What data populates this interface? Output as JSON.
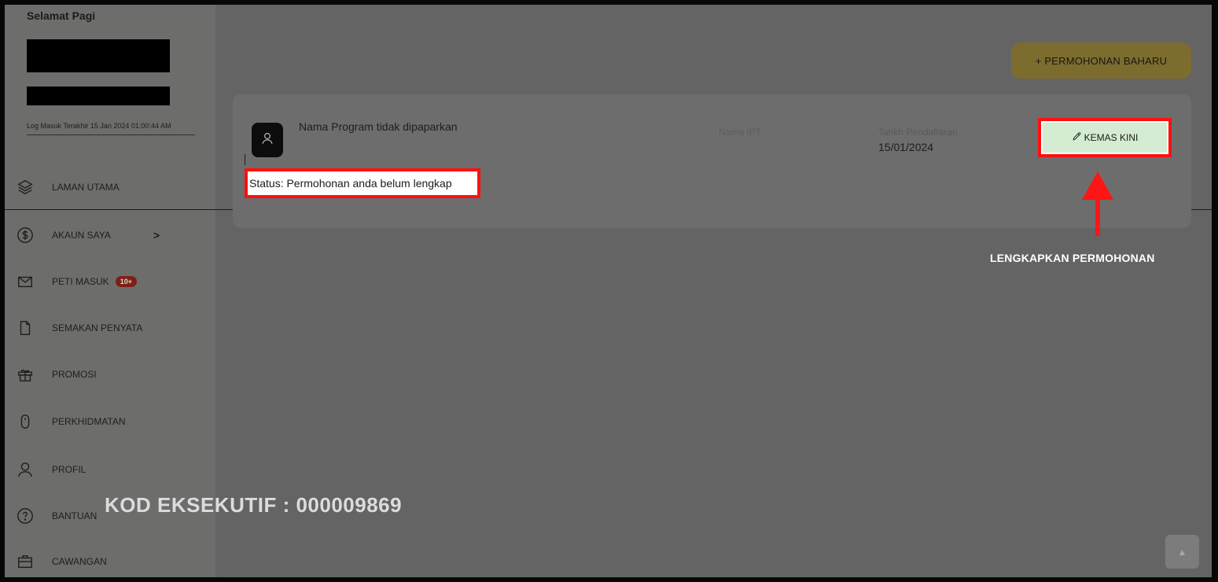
{
  "sidebar": {
    "greeting": "Selamat Pagi",
    "last_login": "Log Masuk Terakhir 15 Jan 2024 01:00:44 AM",
    "items": [
      {
        "label": "LAMAN UTAMA",
        "icon": "layers-icon"
      },
      {
        "label": "AKAUN SAYA",
        "icon": "dollar-circle-icon",
        "chevron": ">"
      },
      {
        "label": "PETI MASUK",
        "icon": "mail-icon",
        "badge": "10+"
      },
      {
        "label": "SEMAKAN PENYATA",
        "icon": "document-icon"
      },
      {
        "label": "PROMOSI",
        "icon": "gift-icon"
      },
      {
        "label": "PERKHIDMATAN",
        "icon": "mouse-icon"
      },
      {
        "label": "PROFIL",
        "icon": "user-icon"
      },
      {
        "label": "BANTUAN",
        "icon": "help-icon"
      },
      {
        "label": "CAWANGAN",
        "icon": "briefcase-icon"
      }
    ]
  },
  "header": {
    "new_application_button": "+ PERMOHONAN BAHARU"
  },
  "application_card": {
    "program_name": "Nama Program tidak dipaparkan",
    "ipt_label": "Nama IPT",
    "registration_date_label": "Tarikh Pendaftaran",
    "registration_date_value": "15/01/2024",
    "update_button": "KEMAS KINI",
    "status_text": "Status: Permohonan anda belum lengkap"
  },
  "annotations": {
    "callout": "LENGKAPKAN PERMOHONAN",
    "watermark": "KOD EKSEKUTIF : 000009869",
    "highlight_color": "#ff1010"
  },
  "colors": {
    "overlay_bg": "#6b6c6b",
    "button_gold": "#7c6c2e",
    "update_green": "#d4ecd2",
    "badge_red": "#7e1f15"
  }
}
